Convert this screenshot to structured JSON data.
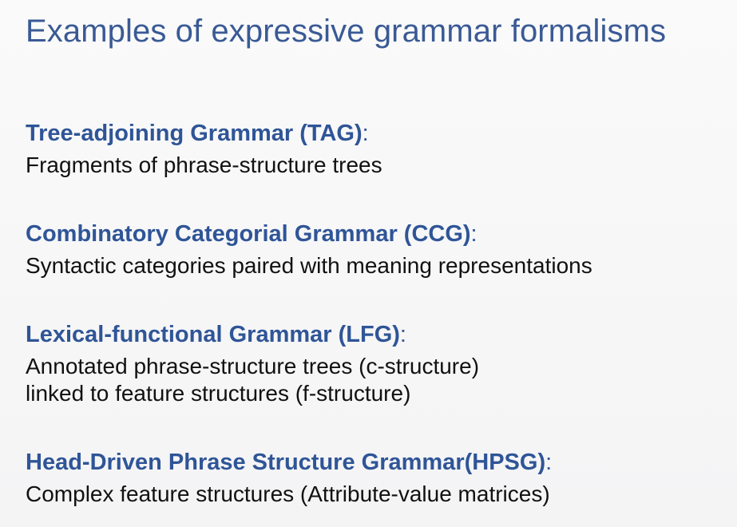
{
  "slide": {
    "title": "Examples of expressive grammar formalisms",
    "sections": [
      {
        "heading": "Tree-adjoining Grammar (TAG)",
        "colon": ":",
        "lines": [
          "Fragments of phrase-structure trees"
        ]
      },
      {
        "heading": "Combinatory Categorial Grammar (CCG)",
        "colon": ":",
        "lines": [
          "Syntactic categories paired with meaning representations"
        ]
      },
      {
        "heading": "Lexical-functional Grammar (LFG)",
        "colon": ":",
        "lines": [
          "Annotated phrase-structure trees (c-structure)",
          "linked to feature structures (f-structure)"
        ]
      },
      {
        "heading": "Head-Driven Phrase Structure Grammar(HPSG)",
        "colon": ":",
        "lines": [
          "Complex feature structures (Attribute-value matrices)"
        ]
      }
    ]
  },
  "colors": {
    "title": "#3a5a95",
    "heading": "#2f5597",
    "body_text": "#111111",
    "background": "#f7f7f8"
  }
}
